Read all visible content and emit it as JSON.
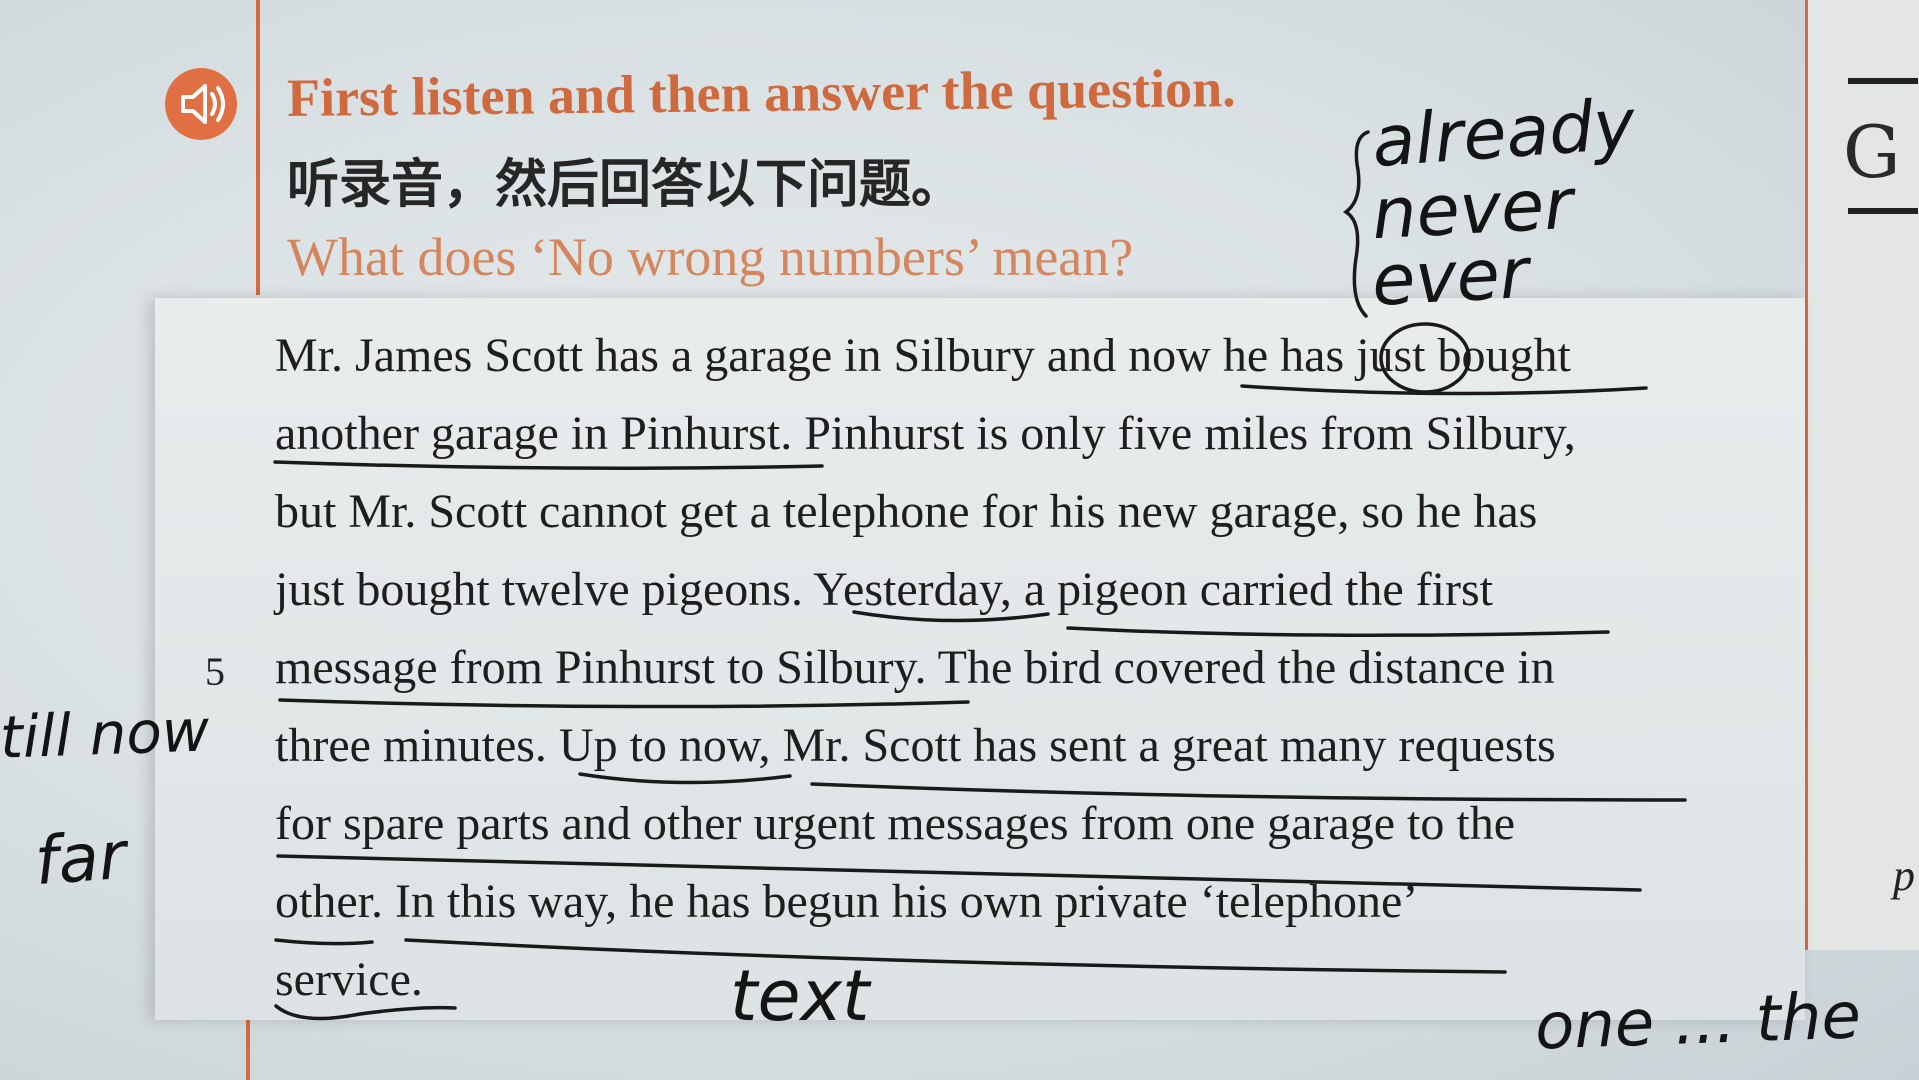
{
  "header": {
    "title": "First listen and then answer the question.",
    "title_cn": "听录音，然后回答以下问题。",
    "question": "What does ‘No wrong numbers’ mean?"
  },
  "passage": {
    "line_number": "5",
    "lines": [
      "Mr. James Scott has a garage in Silbury and now he has just bought",
      "another garage in Pinhurst. Pinhurst is only five miles from Silbury,",
      "but Mr. Scott cannot get a telephone for his new garage, so he has",
      "just bought twelve pigeons. Yesterday, a pigeon carried the first",
      "message from Pinhurst to Silbury. The bird covered the distance in",
      "three minutes. Up to now, Mr. Scott has sent a great many requests",
      "for spare parts and other urgent messages from one garage to the",
      "other. In this way, he has begun his own private ‘telephone’",
      "service."
    ]
  },
  "handwriting": {
    "word1": "already",
    "word2": "never",
    "word3": "ever",
    "margin1": "till now",
    "margin2": "far",
    "bottom": "text",
    "bottom_right": "one ... the"
  },
  "right_page": {
    "glyph": "G",
    "letter": "p"
  },
  "colors": {
    "accent_orange": "#cf6a3f",
    "question_orange": "#d4865e",
    "ink": "#1a1a1a"
  }
}
